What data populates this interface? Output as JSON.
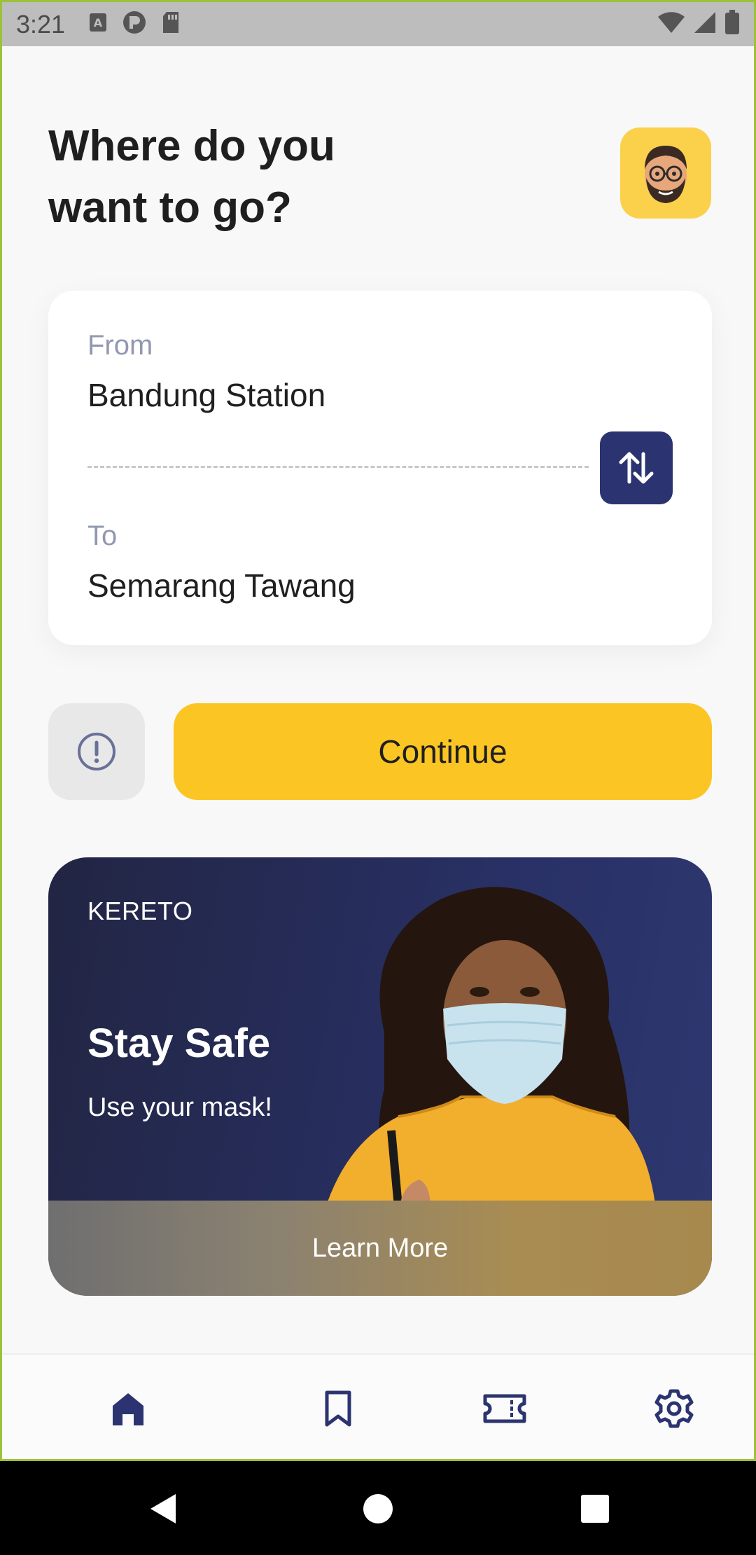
{
  "status_bar": {
    "time": "3:21",
    "left_icons": [
      "a-accessibility-icon",
      "p-record-icon",
      "sd-card-icon"
    ],
    "right_icons": [
      "wifi-icon",
      "signal-icon",
      "battery-icon"
    ]
  },
  "header": {
    "title": "Where do you want to go?",
    "avatar_icon": "memoji-avatar-icon"
  },
  "route": {
    "from_label": "From",
    "from_value": "Bandung Station",
    "to_label": "To",
    "to_value": "Semarang Tawang",
    "swap_icon": "swap-vertical-arrows-icon"
  },
  "actions": {
    "info_icon": "info-circle-icon",
    "continue_label": "Continue"
  },
  "promo": {
    "brand": "KERETO",
    "title": "Stay Safe",
    "subtitle": "Use your mask!",
    "cta": "Learn More"
  },
  "bottom_nav": {
    "items": [
      {
        "icon": "home-icon",
        "active": true
      },
      {
        "icon": "bookmark-icon",
        "active": false
      },
      {
        "icon": "ticket-icon",
        "active": false
      },
      {
        "icon": "gear-icon",
        "active": false
      }
    ]
  },
  "colors": {
    "accent_navy": "#2b3470",
    "accent_yellow": "#fbc524",
    "avatar_bg": "#fbd14b",
    "label_gray": "#9099b0"
  }
}
